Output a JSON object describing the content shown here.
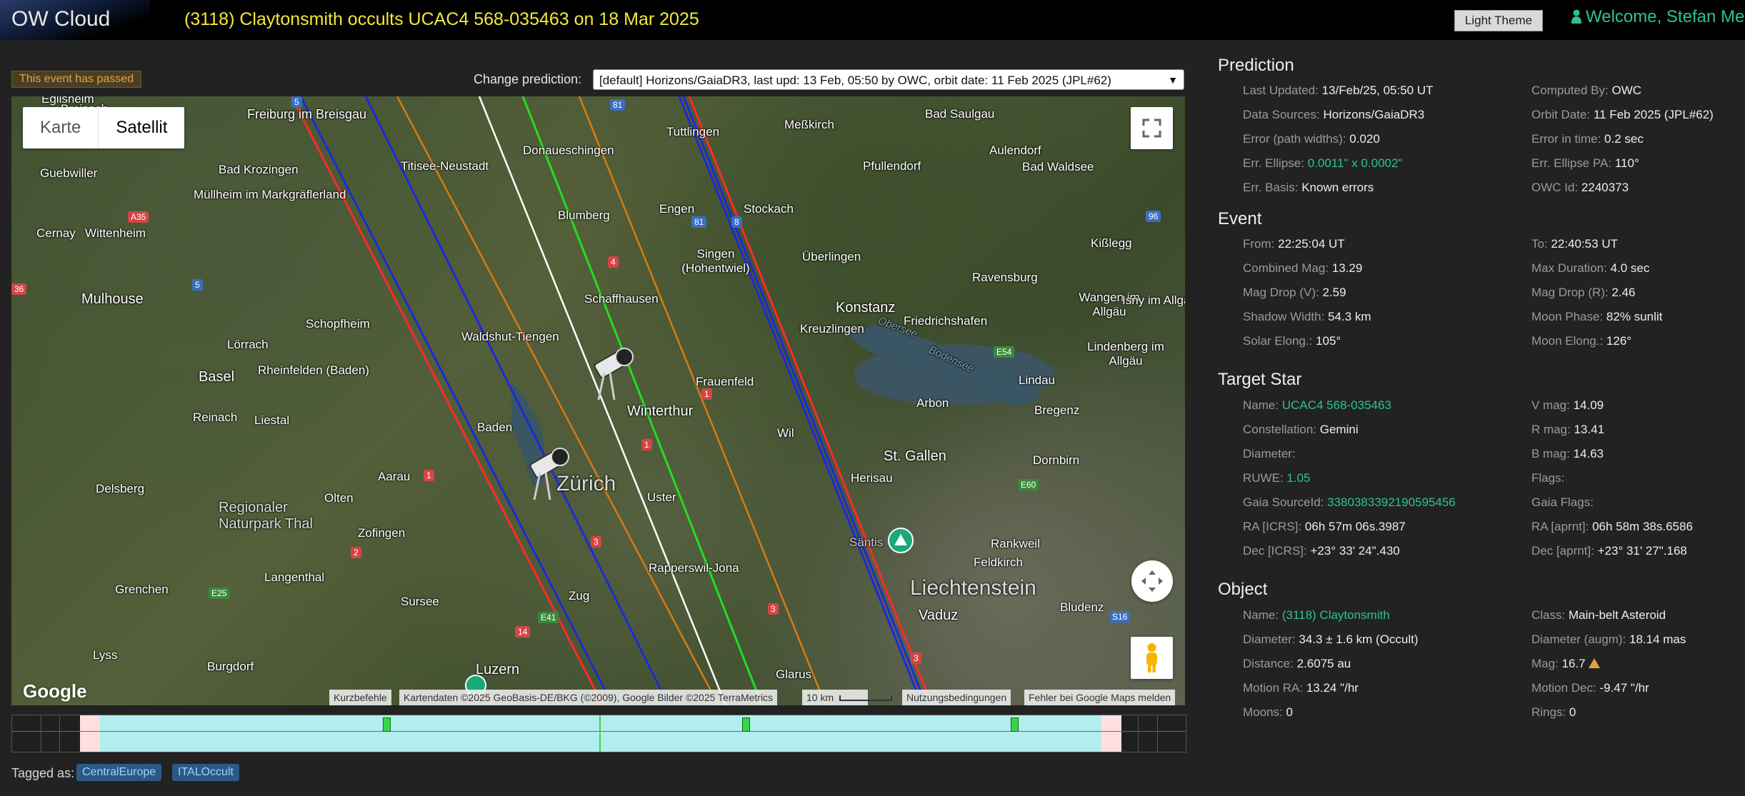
{
  "header": {
    "logo": "OW Cloud",
    "title": "(3118) Claytonsmith occults UCAC4 568-035463 on 18 Mar 2025",
    "theme_button": "Light Theme",
    "welcome": "Welcome, Stefan Meis"
  },
  "status_badge": "This event has passed",
  "prediction_select": {
    "label": "Change prediction:",
    "value": "[default] Horizons/GaiaDR3, last upd: 13 Feb, 05:50 by OWC, orbit date: 11 Feb 2025 (JPL#62)"
  },
  "map": {
    "map_type_tabs": [
      "Karte",
      "Satellit"
    ],
    "active_tab": "Satellit",
    "google_logo": "Google",
    "attribution": {
      "shortcuts": "Kurzbefehle",
      "data": "Kartendaten ©2025 GeoBasis-DE/BKG (©2009), Google Bilder ©2025 TerraMetrics",
      "scale": "10 km",
      "terms": "Nutzungsbedingungen",
      "report": "Fehler bei Google Maps melden"
    },
    "places": [
      "Freiburg im Breisgau",
      "Bad Krozingen",
      "Guebwiller",
      "Müllheim im Markgräflerland",
      "Cernay",
      "Wittenheim",
      "Mulhouse",
      "Schopfheim",
      "Lörrach",
      "Rheinfelden (Baden)",
      "Basel",
      "Reinach",
      "Liestal",
      "Delsberg",
      "Regionaler Naturpark Thal",
      "Olten",
      "Aarau",
      "Zofingen",
      "Langenthal",
      "Grenchen",
      "Sursee",
      "Lyss",
      "Burgdorf",
      "Luzern",
      "Zürich",
      "Baden",
      "Winterthur",
      "Uster",
      "Frauenfeld",
      "Rapperswil-Jona",
      "Zug",
      "Glarus",
      "Konstanz",
      "Kreuzlingen",
      "Friedrichshafen",
      "Arbon",
      "St. Gallen",
      "Herisau",
      "Wil",
      "Dornbirn",
      "Bregenz",
      "Lindau",
      "Lindenberg im Allgäu",
      "Wangen im Allgäu",
      "Isny im Allgäu",
      "Ravensburg",
      "Kißlegg",
      "Bad Waldsee",
      "Aulendorf",
      "Bad Saulgau",
      "Meßkirch",
      "Pfullendorf",
      "Stockach",
      "Engen",
      "Singen (Hohentwiel)",
      "Überlingen",
      "Blumberg",
      "Donaueschingen",
      "Tuttlingen",
      "Titisee-Neustadt",
      "Waldshut-Tiengen",
      "Schaffhausen",
      "Rankweil",
      "Feldkirch",
      "Vaduz",
      "Liechtenstein",
      "Bludenz",
      "Säntis",
      "Eglisheim",
      "Breisach",
      "Obersee",
      "Bodensee"
    ],
    "road_shields": [
      "5",
      "81",
      "A35",
      "5",
      "81",
      "8",
      "96",
      "4",
      "E54",
      "1",
      "1",
      "1",
      "3",
      "2",
      "E60",
      "3",
      "E41",
      "14",
      "E25",
      "3",
      "S16",
      "36"
    ]
  },
  "timeline": {
    "pink_bands": [
      [
        0.058,
        0.075
      ],
      [
        0.928,
        0.945
      ]
    ],
    "cyan_band": [
      0.075,
      0.928
    ],
    "markers": [
      0.319,
      0.625,
      0.854
    ],
    "now": 0.5
  },
  "tags": {
    "label": "Tagged as:",
    "items": [
      "CentralEurope",
      "ITALOccult"
    ]
  },
  "panel": {
    "prediction": {
      "title": "Prediction",
      "fields": [
        {
          "label": "Last Updated:",
          "value": "13/Feb/25, 05:50 UT"
        },
        {
          "label": "Computed By:",
          "value": "OWC"
        },
        {
          "label": "Data Sources:",
          "value": "Horizons/GaiaDR3"
        },
        {
          "label": "Orbit Date:",
          "value": "11 Feb 2025 (JPL#62)"
        },
        {
          "label": "Error (path widths):",
          "value": "0.020"
        },
        {
          "label": "Error in time:",
          "value": "0.2 sec"
        },
        {
          "label": "Err. Ellipse:",
          "value": "0.0011\" x 0.0002\""
        },
        {
          "label": "Err. Ellipse PA:",
          "value": "110°"
        },
        {
          "label": "Err. Basis:",
          "value": "Known errors"
        },
        {
          "label": "OWC Id:",
          "value": "2240373"
        }
      ]
    },
    "event": {
      "title": "Event",
      "fields": [
        {
          "label": "From:",
          "value": "22:25:04 UT"
        },
        {
          "label": "To:",
          "value": "22:40:53 UT"
        },
        {
          "label": "Combined Mag:",
          "value": "13.29"
        },
        {
          "label": "Max Duration:",
          "value": "4.0 sec"
        },
        {
          "label": "Mag Drop (V):",
          "value": "2.59"
        },
        {
          "label": "Mag Drop (R):",
          "value": "2.46"
        },
        {
          "label": "Shadow Width:",
          "value": "54.3 km"
        },
        {
          "label": "Moon Phase:",
          "value": "82% sunlit"
        },
        {
          "label": "Solar Elong.:",
          "value": "105°"
        },
        {
          "label": "Moon Elong.:",
          "value": "126°"
        }
      ]
    },
    "target_star": {
      "title": "Target Star",
      "fields": [
        {
          "label": "Name:",
          "value": "UCAC4 568-035463"
        },
        {
          "label": "V mag:",
          "value": "14.09"
        },
        {
          "label": "Constellation:",
          "value": "Gemini"
        },
        {
          "label": "R mag:",
          "value": "13.41"
        },
        {
          "label": "Diameter:",
          "value": ""
        },
        {
          "label": "B mag:",
          "value": "14.63"
        },
        {
          "label": "RUWE:",
          "value": "1.05"
        },
        {
          "label": "Flags:",
          "value": ""
        },
        {
          "label": "Gaia SourceId:",
          "value": "3380383392190595456"
        },
        {
          "label": "Gaia Flags:",
          "value": ""
        },
        {
          "label": "RA [ICRS]:",
          "value": "06h 57m 06s.3987"
        },
        {
          "label": "RA [aprnt]:",
          "value": "06h 58m 38s.6586"
        },
        {
          "label": "Dec [ICRS]:",
          "value": "+23° 33' 24\".430"
        },
        {
          "label": "Dec [aprnt]:",
          "value": "+23° 31' 27\".168"
        }
      ]
    },
    "object": {
      "title": "Object",
      "fields": [
        {
          "label": "Name:",
          "value": "(3118) Claytonsmith"
        },
        {
          "label": "Class:",
          "value": "Main-belt Asteroid"
        },
        {
          "label": "Diameter:",
          "value": "34.3 ± 1.6 km"
        },
        {
          "label": "Diameter note",
          "value": "(Occult)"
        },
        {
          "label": "Diameter (augm):",
          "value": "18.14 mas"
        },
        {
          "label": "Distance:",
          "value": "2.6075 au"
        },
        {
          "label": "Mag:",
          "value": "16.7"
        },
        {
          "label": "Motion RA:",
          "value": "13.24 \"/hr"
        },
        {
          "label": "Motion Dec:",
          "value": "-9.47 \"/hr"
        },
        {
          "label": "Moons:",
          "value": "0"
        },
        {
          "label": "Rings:",
          "value": "0"
        }
      ]
    }
  },
  "colors": {
    "accent": "#2ec28f",
    "title_yellow": "#f2e83a",
    "warning": "#e0a347",
    "path_center": "#ffffff",
    "path_limit_red": "#ff2a2a",
    "path_limit_blue": "#1b2bd6",
    "path_1sigma_orange": "#d97a10",
    "path_green": "#22dd22",
    "timeline_cyan": "#b2eeee",
    "timeline_pink": "#ffe0e0"
  }
}
